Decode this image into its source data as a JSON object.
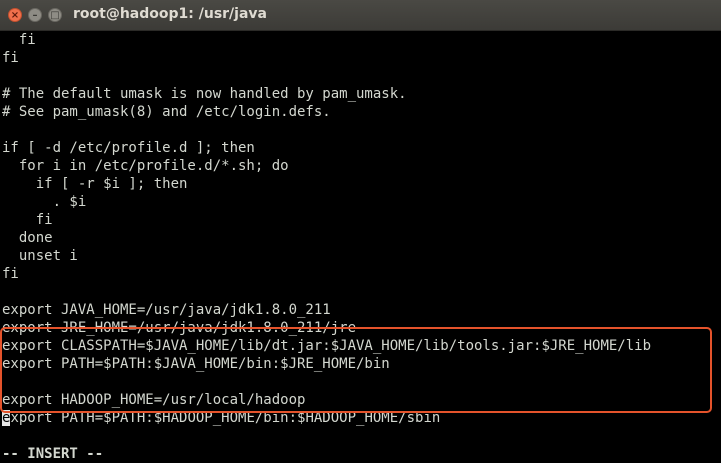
{
  "window": {
    "title": "root@hadoop1: /usr/java",
    "close_glyph": "×",
    "minimize_glyph": "–",
    "maximize_glyph": "□"
  },
  "terminal": {
    "lines": [
      "  fi",
      "fi",
      "",
      "# The default umask is now handled by pam_umask.",
      "# See pam_umask(8) and /etc/login.defs.",
      "",
      "if [ -d /etc/profile.d ]; then",
      "  for i in /etc/profile.d/*.sh; do",
      "    if [ -r $i ]; then",
      "      . $i",
      "    fi",
      "  done",
      "  unset i",
      "fi",
      "",
      "export JAVA_HOME=/usr/java/jdk1.8.0_211",
      "export JRE_HOME=/usr/java/jdk1.8.0_211/jre",
      "export CLASSPATH=$JAVA_HOME/lib/dt.jar:$JAVA_HOME/lib/tools.jar:$JRE_HOME/lib",
      "export PATH=$PATH:$JAVA_HOME/bin:$JRE_HOME/bin",
      "",
      "export HADOOP_HOME=/usr/local/hadoop",
      "xport PATH=$PATH:$HADOOP_HOME/bin:$HADOOP_HOME/sbin",
      "",
      "-- INSERT --"
    ],
    "cursor_char": "e",
    "cursor_line": 21
  },
  "colors": {
    "terminal_bg": "#000000",
    "terminal_fg": "#d3d7cf",
    "highlight_border": "#e5532b",
    "titlebar_bg": "#3c3b37",
    "close_button": "#f0704c"
  }
}
